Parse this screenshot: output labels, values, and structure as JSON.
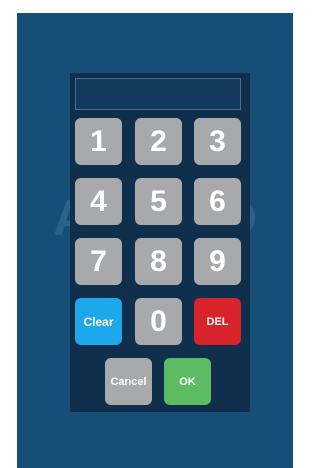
{
  "background_text": {
    "left": "A",
    "right": "O"
  },
  "display": {
    "value": ""
  },
  "keys": {
    "k1": "1",
    "k2": "2",
    "k3": "3",
    "k4": "4",
    "k5": "5",
    "k6": "6",
    "k7": "7",
    "k8": "8",
    "k9": "9",
    "clear": "Clear",
    "k0": "0",
    "del": "DEL",
    "cancel": "Cancel",
    "ok": "OK"
  },
  "colors": {
    "screen_bg": "#154f78",
    "keypad_bg": "#102f4c",
    "number_key": "#a8a9ab",
    "clear_key": "#1ea8ec",
    "del_key": "#d9232b",
    "ok_key": "#5dbb63"
  }
}
